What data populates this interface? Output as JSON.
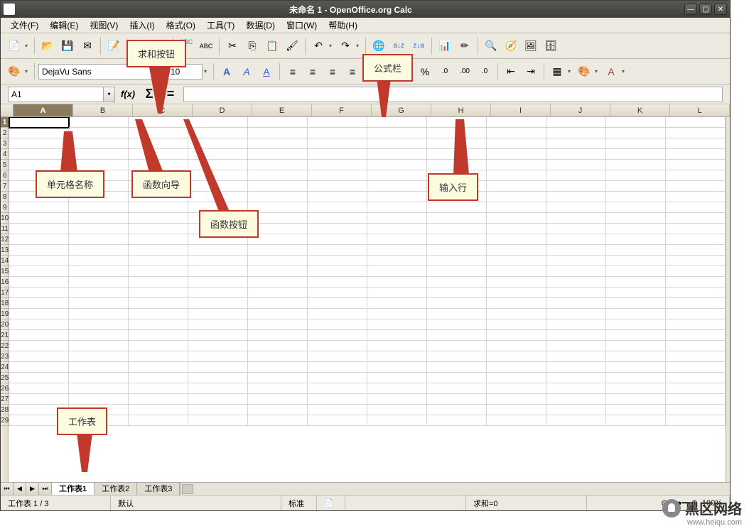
{
  "window": {
    "title": "未命名 1 - OpenOffice.org Calc"
  },
  "menu": {
    "file": "文件(F)",
    "edit": "编辑(E)",
    "view": "视图(V)",
    "insert": "插入(I)",
    "format": "格式(O)",
    "tools": "工具(T)",
    "data": "数据(D)",
    "window": "窗口(W)",
    "help": "帮助(H)"
  },
  "font": {
    "name": "DejaVu Sans",
    "size": "10"
  },
  "formula": {
    "cell_ref": "A1",
    "fx": "f(x)",
    "sigma": "Σ",
    "equals": "="
  },
  "columns": [
    "A",
    "B",
    "C",
    "D",
    "E",
    "F",
    "G",
    "H",
    "I",
    "J",
    "K",
    "L"
  ],
  "rows": [
    1,
    2,
    3,
    4,
    5,
    6,
    7,
    8,
    9,
    10,
    11,
    12,
    13,
    14,
    15,
    16,
    17,
    18,
    19,
    20,
    21,
    22,
    23,
    24,
    25,
    26,
    27,
    28,
    29
  ],
  "tabs": {
    "sheet1": "工作表1",
    "sheet2": "工作表2",
    "sheet3": "工作表3"
  },
  "status": {
    "sheet": "工作表 1 / 3",
    "style": "默认",
    "mode": "标准",
    "sum": "求和=0",
    "zoom": "100%"
  },
  "callouts": {
    "sum_btn": "求和按钮",
    "formula_bar": "公式栏",
    "cell_name": "单元格名称",
    "fx_wizard": "函数向导",
    "fx_btn": "函数按钮",
    "input_line": "输入行",
    "worksheet": "工作表"
  },
  "watermark": {
    "title": "黑区网络",
    "url": "www.heiqu.com"
  }
}
